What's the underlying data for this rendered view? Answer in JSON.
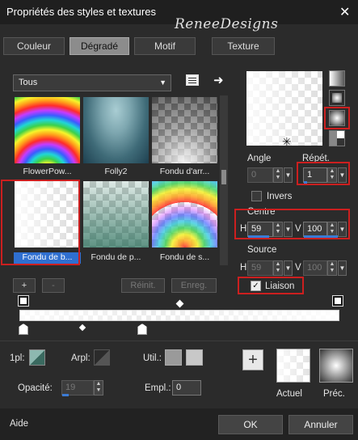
{
  "window": {
    "title": "Propriétés des styles et textures",
    "close_glyph": "✕",
    "watermark": "ReneeDesigns"
  },
  "tabs": [
    {
      "label": "Couleur"
    },
    {
      "label": "Dégradé",
      "active": true
    },
    {
      "label": "Motif"
    },
    {
      "label": "Texture"
    }
  ],
  "category": {
    "value": "Tous"
  },
  "swatches": [
    {
      "label": "FlowerPow..."
    },
    {
      "label": "Folly2"
    },
    {
      "label": "Fondu d'arr..."
    },
    {
      "label": "Fondu de b...",
      "selected": true
    },
    {
      "label": "Fondu de p..."
    },
    {
      "label": "Fondu de s..."
    }
  ],
  "list_buttons": {
    "add": "+",
    "remove": "-",
    "reset": "Réinit.",
    "save": "Enreg."
  },
  "angle": {
    "label": "Angle",
    "value": "0"
  },
  "repeat": {
    "label": "Répét.",
    "value": "1"
  },
  "invert": {
    "label": "Invers"
  },
  "center": {
    "label": "Centre",
    "h_label": "H",
    "h_value": "59",
    "v_label": "V",
    "v_value": "100"
  },
  "source": {
    "label": "Source",
    "h_label": "H",
    "h_value": "59",
    "v_label": "V",
    "v_value": "100"
  },
  "link": {
    "label": "Liaison",
    "checked": true
  },
  "bottom": {
    "pl_label": "1pl:",
    "arpl_label": "Arpl:",
    "util_label": "Util.:",
    "opacity_label": "Opacité:",
    "opacity_value": "19",
    "empl_label": "Empl.:",
    "empl_value": "0"
  },
  "preview": {
    "current_label": "Actuel",
    "previous_label": "Préc.",
    "add_glyph": "+"
  },
  "footer": {
    "help": "Aide",
    "ok": "OK",
    "cancel": "Annuler"
  },
  "colors": {
    "highlight": "#cc1f1f",
    "accent": "#3b7bd4"
  }
}
